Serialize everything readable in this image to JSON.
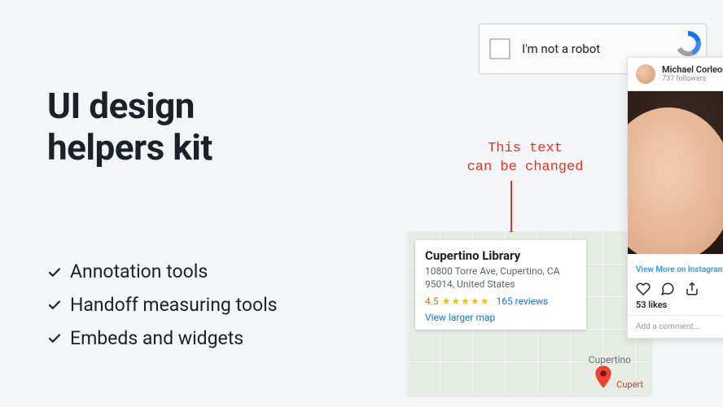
{
  "title": {
    "line1": "UI design",
    "line2": "helpers kit"
  },
  "features": [
    "Annotation tools",
    "Handoff measuring tools",
    "Embeds and widgets"
  ],
  "recaptcha": {
    "label": "I'm not a robot"
  },
  "annotation": {
    "line1": "This text",
    "line2": "can be changed"
  },
  "map": {
    "place_name": "Cupertino Library",
    "address": "10800 Torre Ave, Cupertino, CA 95014, United States",
    "rating": "4.5",
    "stars": "★★★★½",
    "reviews_label": "165 reviews",
    "view_larger": "View larger map",
    "city_label": "Cupertino",
    "pin_label": "Cupert"
  },
  "instagram": {
    "username": "Michael Corleone",
    "followers": "737 followers",
    "view_more": "View More on Instagram",
    "likes": "53 likes",
    "comment_placeholder": "Add a comment..."
  }
}
